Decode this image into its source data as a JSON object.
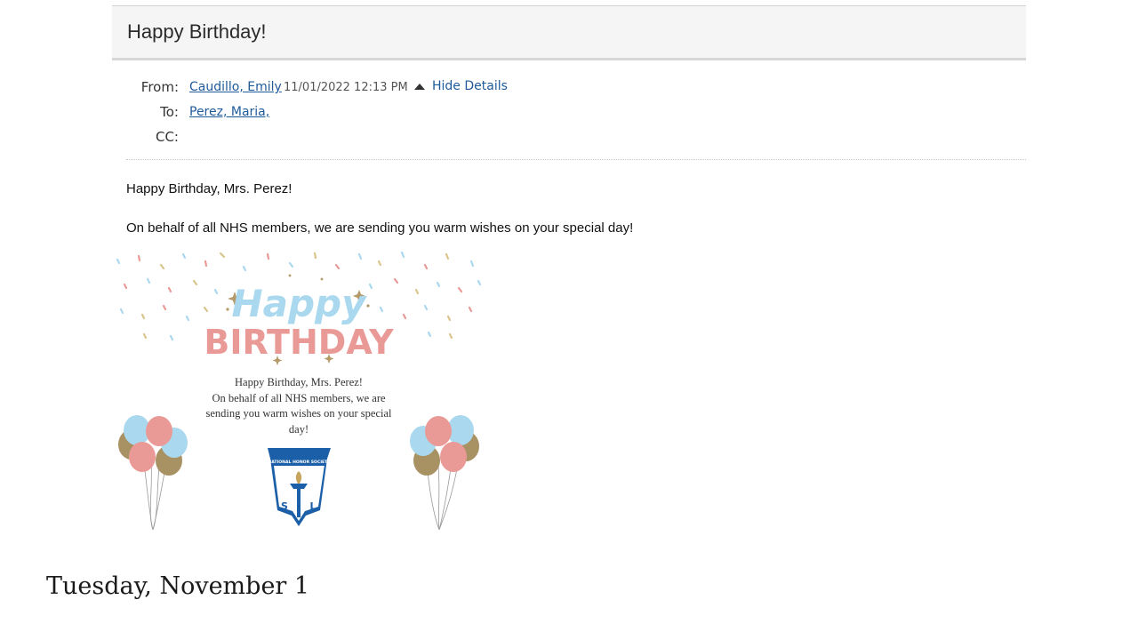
{
  "email": {
    "subject": "Happy Birthday!",
    "from_label": "From:",
    "from_name": "Caudillo, Emily",
    "date": "11/01/2022 12:13 PM",
    "hide_details": "Hide Details",
    "to_label": "To:",
    "to_name": "Perez, Maria,",
    "cc_label": "CC:",
    "body_line1": "Happy Birthday, Mrs. Perez!",
    "body_line2": "On behalf of all NHS members, we are sending you warm wishes on your special day!"
  },
  "card": {
    "happy": "Happy",
    "birthday": "BIRTHDAY",
    "line1": "Happy Birthday, Mrs. Perez!",
    "line2": "On behalf of all NHS members, we are sending you warm wishes on your special day!",
    "logo_text": "NATIONAL HONOR SOCIETY",
    "logo_letters_left": "S",
    "logo_letters_right": "L",
    "colors": {
      "blue": "#a9d8ef",
      "pink": "#ea9a96",
      "gold": "#a89163",
      "navy": "#1b5fa8"
    }
  },
  "footer": {
    "date_heading": "Tuesday, November 1"
  },
  "icons": {
    "hide_details_icon": "triangle-up-icon"
  }
}
